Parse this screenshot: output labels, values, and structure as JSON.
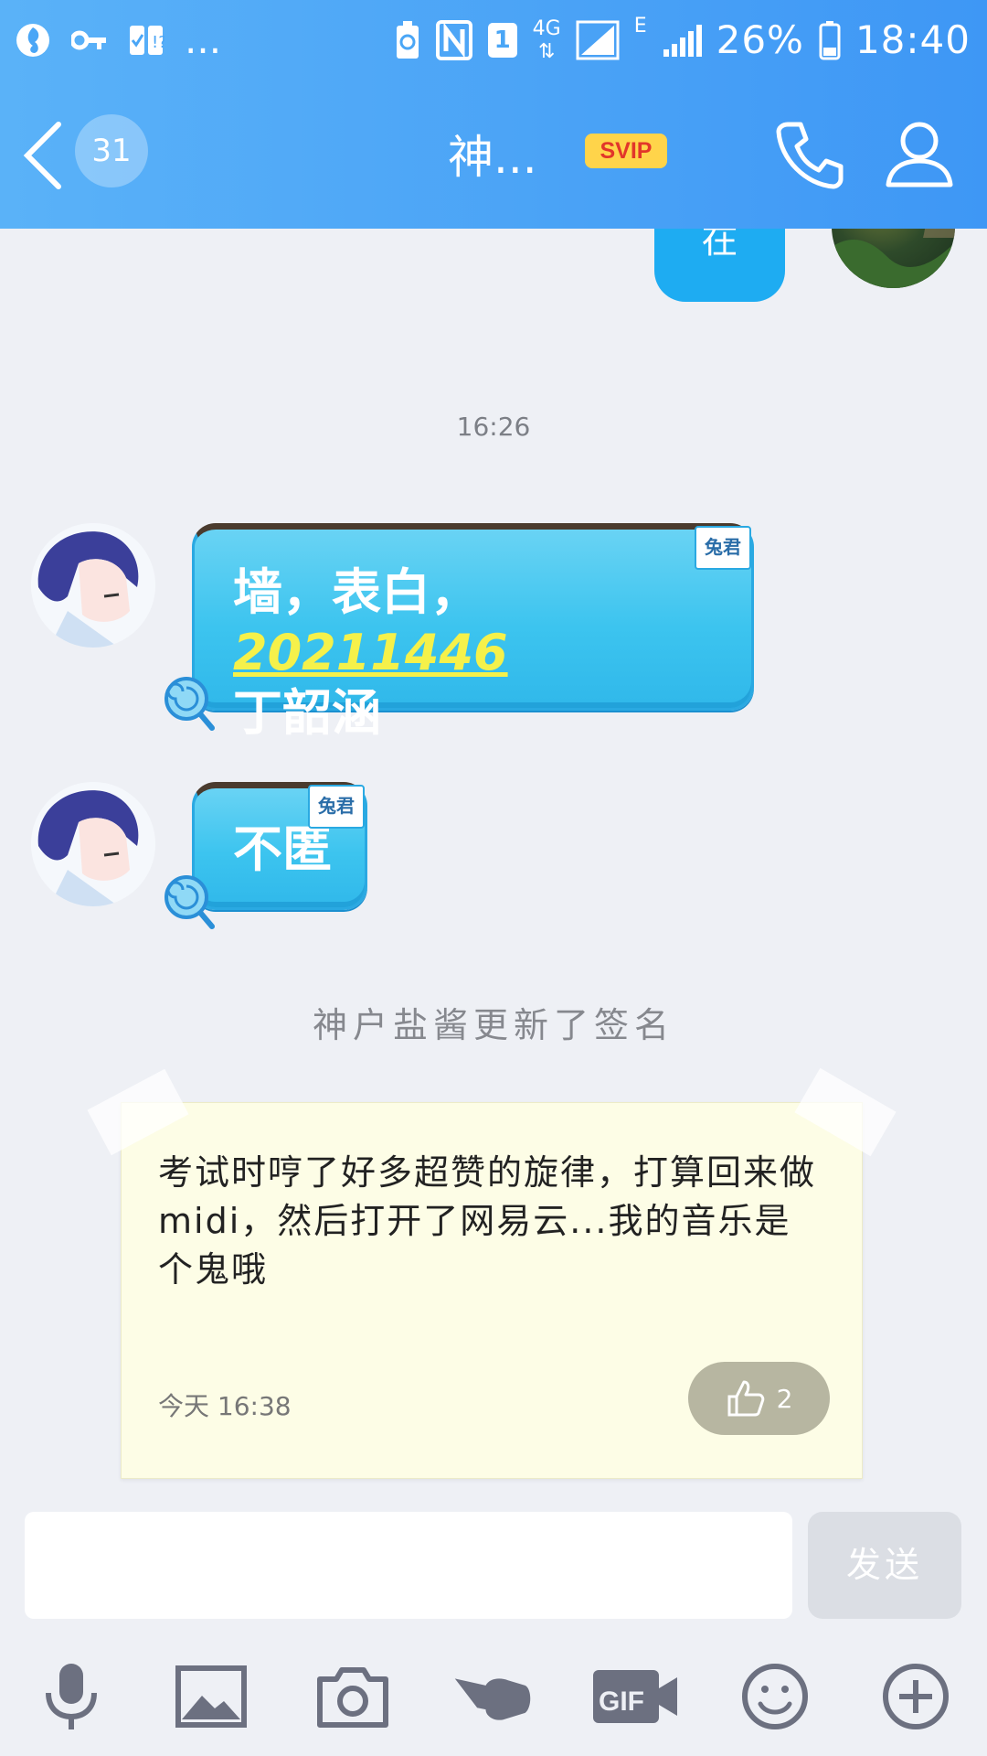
{
  "status_bar": {
    "overflow": "...",
    "network": "4G",
    "network_e": "E",
    "sim_slot": "1",
    "battery_percent": "26%",
    "time": "18:40"
  },
  "header": {
    "unread_count": "31",
    "title": "神...",
    "svip_label": "SVIP",
    "accent_color": "#3e97f5"
  },
  "chat": {
    "previous_message": "在",
    "timestamp": "16:26",
    "messages": [
      {
        "text_line1": "墙，表白，",
        "link": "20211446",
        "text_line2": "丁韶涵",
        "tag": "兔君"
      },
      {
        "text": "不匿",
        "tag": "兔君"
      }
    ],
    "system_notice": "神户盐酱更新了签名",
    "signature_card": {
      "text": "考试时哼了好多超赞的旋律，打算回来做midi，然后打开了网易云...我的音乐是个鬼哦",
      "date": "今天 16:38",
      "likes": "2"
    }
  },
  "input": {
    "value": "",
    "send_label": "发送"
  },
  "toolbar": {
    "items": [
      "mic-icon",
      "image-icon",
      "camera-icon",
      "poke-icon",
      "gif-icon",
      "emoji-icon",
      "plus-icon"
    ]
  }
}
